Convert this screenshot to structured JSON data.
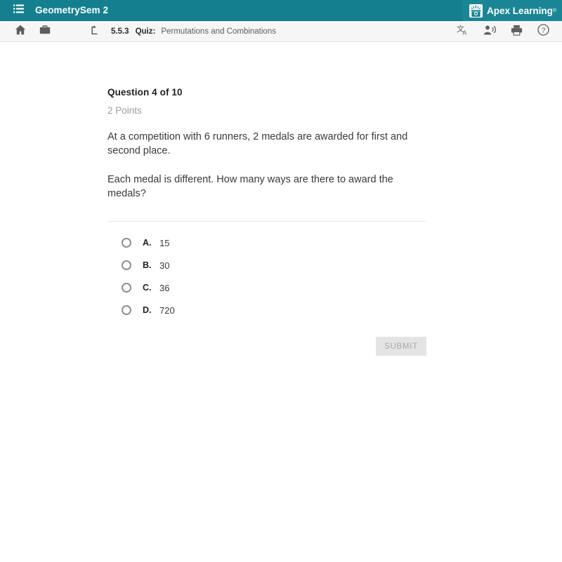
{
  "header": {
    "menu_icon": "hamburger-menu-icon",
    "course_title": "GeometrySem 2",
    "brand_name": "Apex Learning",
    "brand_tm": "®",
    "brand_mark_icon": "apex-logo-icon",
    "accent_color": "#14808f"
  },
  "toolbar": {
    "home_icon": "home-icon",
    "briefcase_icon": "briefcase-icon",
    "up_level_icon": "up-level-arrow-icon",
    "breadcrumb": {
      "number": "5.5.3",
      "type": "Quiz:",
      "name": "Permutations and Combinations"
    },
    "right_icons": [
      {
        "name": "translate-icon",
        "label": "文A"
      },
      {
        "name": "text-to-speech-icon",
        "label": "read aloud"
      },
      {
        "name": "print-icon",
        "label": "print"
      },
      {
        "name": "help-icon",
        "label": "?"
      }
    ]
  },
  "question": {
    "heading": "Question 4 of 10",
    "points": "2 Points",
    "paragraph_1": "At a competition with 6 runners, 2 medals are awarded for first and second place.",
    "paragraph_2": "Each medal is different. How many ways are there to award the medals?",
    "options": [
      {
        "letter": "A.",
        "value": "15",
        "selected": false
      },
      {
        "letter": "B.",
        "value": "30",
        "selected": false
      },
      {
        "letter": "C.",
        "value": "36",
        "selected": false
      },
      {
        "letter": "D.",
        "value": "720",
        "selected": false
      }
    ],
    "submit_label": "SUBMIT",
    "submit_disabled": true
  }
}
